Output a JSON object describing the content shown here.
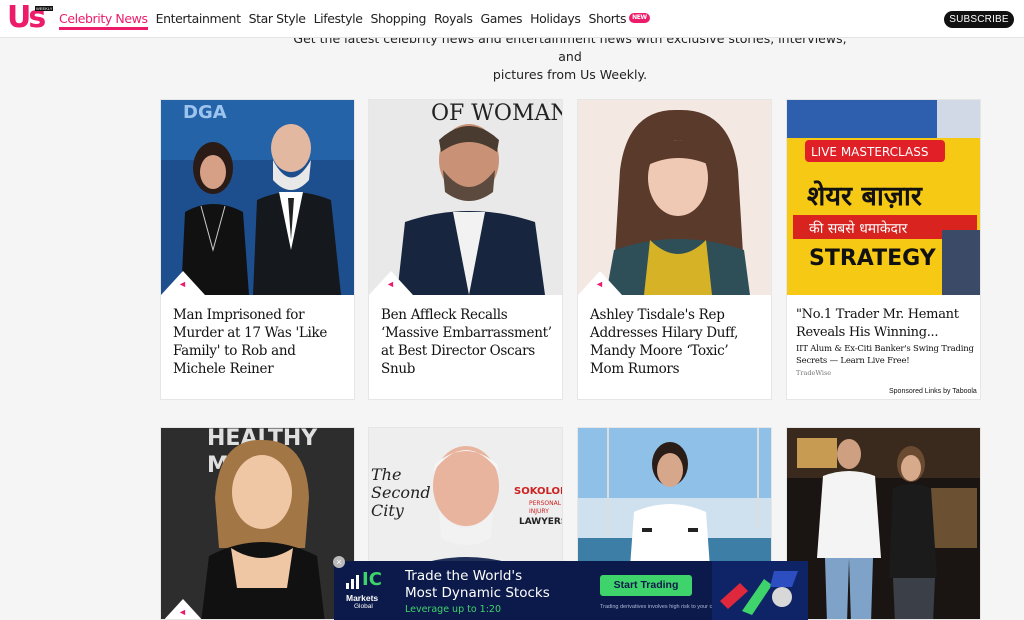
{
  "nav": {
    "logo": "Us",
    "logo_sub": "WEEKLY",
    "links": [
      {
        "label": "Celebrity News",
        "active": true
      },
      {
        "label": "Entertainment"
      },
      {
        "label": "Star Style"
      },
      {
        "label": "Lifestyle"
      },
      {
        "label": "Shopping"
      },
      {
        "label": "Royals"
      },
      {
        "label": "Games"
      },
      {
        "label": "Holidays"
      },
      {
        "label": "Shorts",
        "badge": "NEW"
      }
    ],
    "subscribe_label": "SUBSCRIBE"
  },
  "intro": {
    "line1": "Get the latest celebrity news and entertainment news with exclusive stories, interviews, and",
    "line2": "pictures from Us Weekly."
  },
  "cards": [
    {
      "title": "Man Imprisoned for Murder at 17 Was 'Like Family' to Rob and Michele Reiner",
      "category_icon": "megaphone-icon"
    },
    {
      "title": "Ben Affleck Recalls ‘Massive Embarrassment’ at Best Director Oscars Snub",
      "category_icon": "megaphone-icon",
      "image_text": "OF WOMAN"
    },
    {
      "title": "Ashley Tisdale's Rep Addresses Hilary Duff, Mandy Moore ‘Toxic’ Mom Rumors",
      "category_icon": "megaphone-icon"
    },
    {
      "sponsored": true,
      "image_badge": "LIVE MASTERCLASS",
      "image_line1": "शेयर बाज़ार",
      "image_line2": "की सबसे धमाकेदार",
      "image_line3": "STRATEGY",
      "title": "\"No.1 Trader Mr. Hemant Reveals His Winning...",
      "description": "IIT Alum & Ex-Citi Banker's Swing Trading Secrets — Learn Live Free!",
      "source": "TradeWise"
    }
  ],
  "row2": [
    {
      "image_text": "HEALTHY",
      "image_text2": "M"
    },
    {
      "image_text": "The",
      "image_text2": "Second",
      "image_text3": "City",
      "image_text4": "SOKOLOF",
      "image_text5": "PERSONAL",
      "image_text6": "INJURY",
      "image_text7": "LAWYERS"
    },
    {},
    {}
  ],
  "sponsored_label": "Sponsored Links by Taboola",
  "banner": {
    "brand_ic": "IC",
    "brand_markets": "Markets",
    "brand_global": "Global",
    "headline1": "Trade the World's",
    "headline2": "Most Dynamic Stocks",
    "subline": "Leverage up to 1:20",
    "cta": "Start Trading",
    "disclaimer": "Trading derivatives involves high risk to your capital.",
    "close": "×",
    "accent": "#3fd36b"
  },
  "colors": {
    "brand": "#ec1c6a",
    "card_bg": "#ffffff",
    "page_bg": "#f5f5f5"
  }
}
